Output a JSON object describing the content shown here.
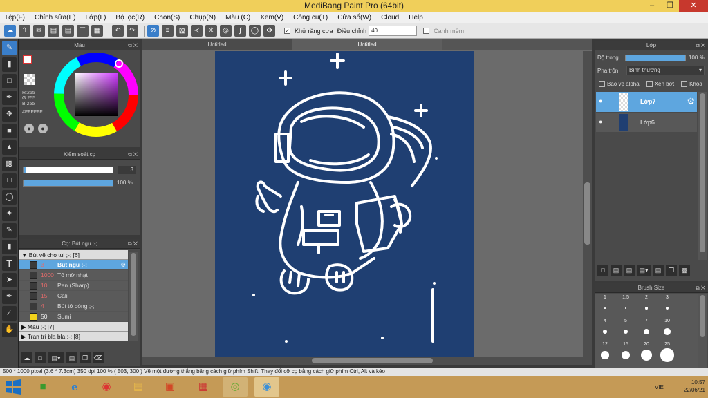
{
  "window": {
    "title": "MediBang Paint Pro (64bit)"
  },
  "menu": [
    "Tệp(F)",
    "Chỉnh sửa(E)",
    "Lớp(L)",
    "Bộ lọc(R)",
    "Chọn(S)",
    "Chụp(N)",
    "Màu (C)",
    "Xem(V)",
    "Công cụ(T)",
    "Cửa sổ(W)",
    "Cloud",
    "Help"
  ],
  "toolbar": {
    "antialias_label": "Khử răng cưa",
    "adjust_label": "Điều chỉnh",
    "adjust_value": "40",
    "smooth_label": "Canh mềm"
  },
  "color_panel": {
    "title": "Màu",
    "r": "R:255",
    "g": "G:255",
    "b": "B:255",
    "hex": "#FFFFFF"
  },
  "brush_control": {
    "title": "Kiểm soát cọ",
    "size_value": "3",
    "opacity_value": "100 %",
    "opacity": 1.0
  },
  "brush_panel": {
    "title": "Cọ: Bút ngu ;-;",
    "groups": [
      {
        "label": "Bút vẽ cho tui ;-; [6]"
      },
      {
        "label": "Màu ;-; [7]"
      },
      {
        "label": "Tran trí bla bla ;-; [8]"
      }
    ],
    "items": [
      {
        "size": "3",
        "name": "Bút ngu ;-;"
      },
      {
        "size": "1000",
        "name": "Tô mờ nhạt"
      },
      {
        "size": "10",
        "name": "Pen (Sharp)"
      },
      {
        "size": "15",
        "name": "Cali"
      },
      {
        "size": "4",
        "name": "Bút tô bóng ;-;"
      },
      {
        "size": "50",
        "name": "Sumi"
      }
    ]
  },
  "tabs": [
    "Untitled",
    "Untitled"
  ],
  "layer_panel": {
    "title": "Lớp",
    "opacity_label": "Độ trong",
    "opacity_value": "100 %",
    "blend_label": "Pha trộn",
    "blend_value": "Bình thường",
    "protect_alpha": "Bảo vệ alpha",
    "clip": "Xén bớt",
    "lock": "Khóa",
    "layers": [
      {
        "name": "Lớp7"
      },
      {
        "name": "Lớp6"
      }
    ]
  },
  "brush_size_panel": {
    "title": "Brush Size",
    "sizes": [
      "1",
      "1.5",
      "2",
      "3",
      "4",
      "5",
      "7",
      "10",
      "12",
      "15",
      "20",
      "25"
    ]
  },
  "status": "500 * 1000 pixel   (3.6 * 7.3cm)   350 dpi   100 %   ( 503, 300 )   Vẽ một đường thẳng bằng cách giữ phím Shift, Thay đổi cỡ cọ bằng cách giữ phím Ctrl, Alt và kéo",
  "taskbar": {
    "lang": "VIE",
    "time": "10:57",
    "date": "22/06/21"
  },
  "colors": {
    "canvas": "#1f3f72",
    "accent": "#5ea6df",
    "title": "#f0cf5a"
  }
}
